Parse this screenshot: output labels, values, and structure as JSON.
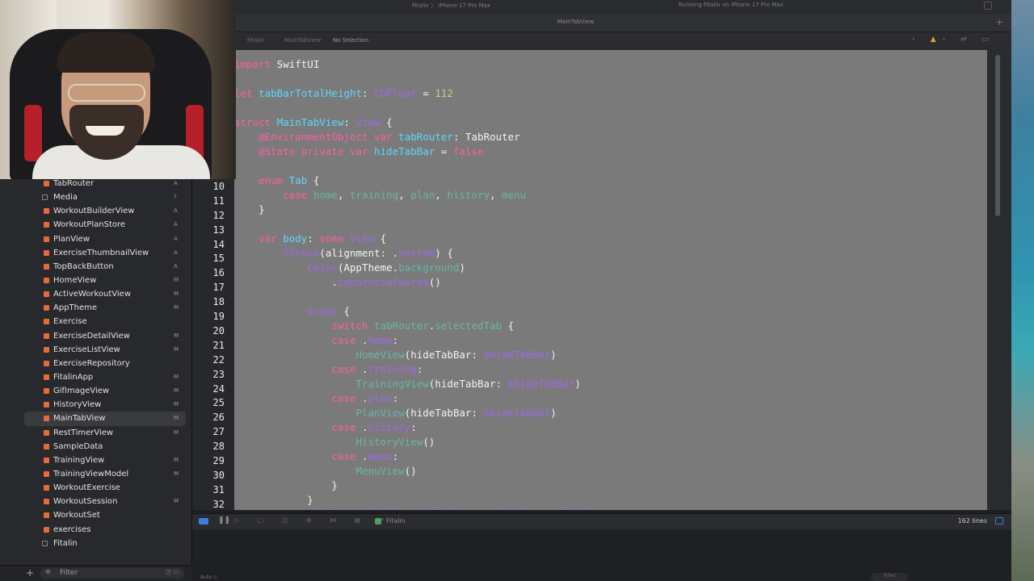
{
  "titlebar": {
    "scheme": "Fitalin  〉 iPhone 17 Pro Max",
    "run_status": "Running Fitalin on iPhone 17 Pro Max"
  },
  "tabbar": {
    "active_tab": "MainTabView"
  },
  "jumpbar": {
    "crumb_project": "Fitalin",
    "crumb_file": "MainTabView",
    "crumb_selection": "No Selection"
  },
  "sidebar": {
    "items": [
      {
        "label": "TabRouter",
        "status": "A"
      },
      {
        "label": "Media",
        "status": "?",
        "folder": true
      },
      {
        "label": "WorkoutBuilderView",
        "status": "A"
      },
      {
        "label": "WorkoutPlanStore",
        "status": "A"
      },
      {
        "label": "PlanView",
        "status": "A"
      },
      {
        "label": "ExerciseThumbnailView",
        "status": "A"
      },
      {
        "label": "TopBackButton",
        "status": "A"
      },
      {
        "label": "HomeView",
        "status": "M"
      },
      {
        "label": "ActiveWorkoutView",
        "status": "M"
      },
      {
        "label": "AppTheme",
        "status": "M"
      },
      {
        "label": "Exercise",
        "status": ""
      },
      {
        "label": "ExerciseDetailView",
        "status": "M"
      },
      {
        "label": "ExerciseListView",
        "status": "M"
      },
      {
        "label": "ExerciseRepository",
        "status": ""
      },
      {
        "label": "FitalinApp",
        "status": "M"
      },
      {
        "label": "GifImageView",
        "status": "M"
      },
      {
        "label": "HistoryView",
        "status": "M"
      },
      {
        "label": "MainTabView",
        "status": "M",
        "selected": true
      },
      {
        "label": "RestTimerView",
        "status": "M"
      },
      {
        "label": "SampleData",
        "status": ""
      },
      {
        "label": "TrainingView",
        "status": "M"
      },
      {
        "label": "TrainingViewModel",
        "status": "M"
      },
      {
        "label": "WorkoutExercise",
        "status": ""
      },
      {
        "label": "WorkoutSession",
        "status": "M"
      },
      {
        "label": "WorkoutSet",
        "status": ""
      },
      {
        "label": "exercises",
        "status": ""
      },
      {
        "label": "Fitalin",
        "status": "",
        "folder": true
      }
    ],
    "filter_placeholder": "Filter"
  },
  "gutter": {
    "line_numbers": [
      "9",
      "10",
      "11",
      "12",
      "13",
      "14",
      "15",
      "16",
      "17",
      "18",
      "19",
      "20",
      "21",
      "22",
      "23",
      "24",
      "25",
      "26",
      "27",
      "28",
      "29",
      "30",
      "31",
      "32"
    ]
  },
  "debugbar": {
    "target": "Fitalin",
    "line_count": "162 lines"
  },
  "console": {
    "mode": "Auto ◇",
    "filter": "Filter"
  },
  "colors": {
    "keyword": "#fc5fa3",
    "type": "#5dd8ff",
    "function": "#67b7a4",
    "property": "#a167e6",
    "number": "#d9c97c",
    "accent": "#3d7ee0"
  }
}
